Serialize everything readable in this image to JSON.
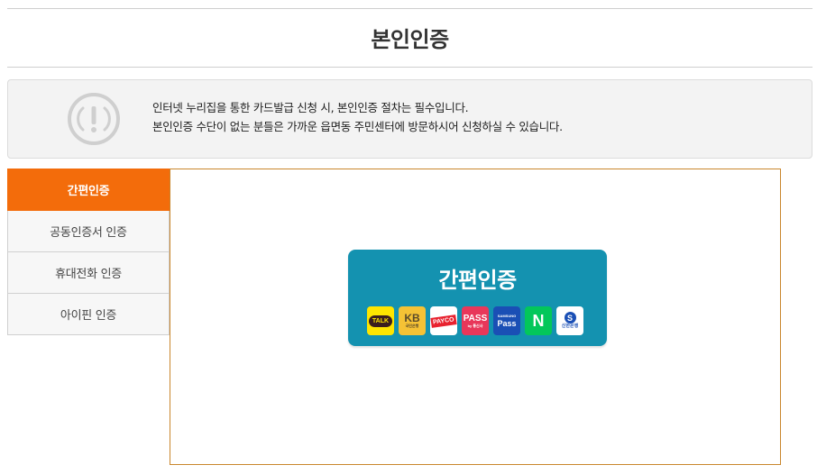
{
  "page": {
    "title": "본인인증"
  },
  "notice": {
    "icon": "exclamation-circle-icon",
    "line1": "인터넷 누리집을 통한 카드발급 신청 시, 본인인증 절차는 필수입니다.",
    "line2": "본인인증 수단이 없는 분들은 가까운 읍면동 주민센터에 방문하시어 신청하실 수 있습니다."
  },
  "tabs": [
    {
      "label": "간편인증",
      "active": true
    },
    {
      "label": "공동인증서 인증",
      "active": false
    },
    {
      "label": "휴대전화 인증",
      "active": false
    },
    {
      "label": "아이핀 인증",
      "active": false
    }
  ],
  "easy_auth": {
    "title": "간편인증",
    "logos": {
      "kakao": "TALK",
      "kb_big": "KB",
      "kb_small": "국민은행",
      "payco": "PAYCO",
      "pass_big": "PASS",
      "pass_small": "by 통신사",
      "samsung_small": "SAMSUNG",
      "samsung_big": "Pass",
      "naver": "N",
      "shinhan_mark": "S",
      "shinhan_small": "신한은행"
    }
  },
  "colors": {
    "active_tab": "#f36c0b",
    "panel_border": "#c9862c",
    "easy_button": "#1492b0"
  }
}
